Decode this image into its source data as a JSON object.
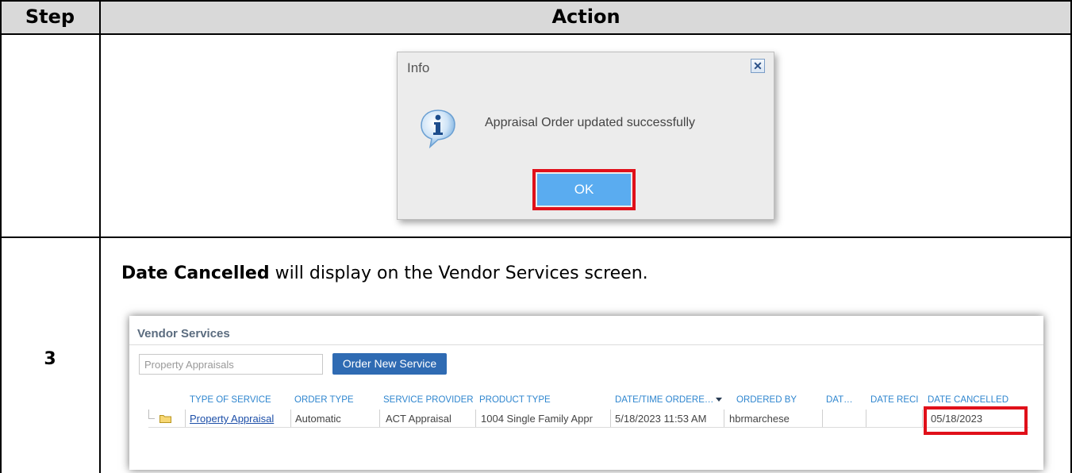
{
  "table": {
    "header_step": "Step",
    "header_action": "Action",
    "step_number": "3"
  },
  "dialog": {
    "title": "Info",
    "close_glyph": "✕",
    "message": "Appraisal Order updated successfully",
    "ok_label": "OK",
    "icon": "info-speech-bubble-icon"
  },
  "instruction": {
    "bold": "Date Cancelled",
    "rest": " will display on the Vendor Services screen."
  },
  "vendor_services": {
    "title": "Vendor Services",
    "search_placeholder": "Property Appraisals",
    "order_button": "Order New Service",
    "columns": [
      "TYPE OF SERVICE",
      "ORDER TYPE",
      "SERVICE PROVIDER",
      "PRODUCT TYPE",
      "DATE/TIME ORDERE…",
      "ORDERED BY",
      "DAT…",
      "DATE RECI",
      "DATE CANCELLED"
    ],
    "row": {
      "type_of_service": "Property Appraisal",
      "order_type": "Automatic",
      "service_provider": "ACT Appraisal",
      "product_type": "1004 Single Family Appr",
      "date_time_ordered": "5/18/2023 11:53 AM",
      "ordered_by": "hbrmarchese",
      "dat": "",
      "date_received": "",
      "date_cancelled": "05/18/2023"
    }
  },
  "colors": {
    "highlight": "#e0101a",
    "header_bg": "#d9d9d9",
    "ok_button": "#5aacf0",
    "order_button": "#2f6bb3",
    "column_header": "#2f86cf"
  }
}
